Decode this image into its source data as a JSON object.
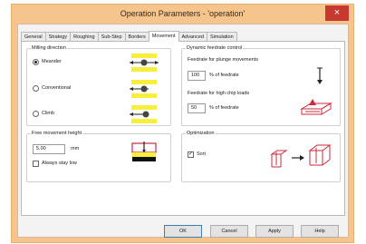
{
  "window": {
    "title": "Operation Parameters - 'operation'",
    "close_glyph": "×"
  },
  "tabs": [
    "General",
    "Strategy",
    "Roughing",
    "Sub-Step",
    "Borders",
    "Movement",
    "Advanced",
    "Simulation"
  ],
  "active_tab": "Movement",
  "milling_direction": {
    "title": "Milling direction",
    "options": [
      {
        "label": "Meander",
        "selected": true,
        "icon": "meander-direction-icon"
      },
      {
        "label": "Conventional",
        "selected": false,
        "icon": "conventional-direction-icon"
      },
      {
        "label": "Climb",
        "selected": false,
        "icon": "climb-direction-icon"
      }
    ]
  },
  "free_movement": {
    "title": "Free movement height",
    "height_value": "5.00",
    "unit": "mm",
    "always_stay_low_label": "Always stay low",
    "always_stay_low_checked": false,
    "icon": "free-movement-height-icon"
  },
  "dynamic_feedrate": {
    "title": "Dynamic feedrate control",
    "plunge_label": "Feedrate for plunge movements",
    "plunge_value": "100",
    "plunge_unit": "% of feedrate",
    "plunge_icon": "plunge-arrow-icon",
    "chip_label": "Feedrate for high chip loads",
    "chip_value": "50",
    "chip_unit": "% of feedrate",
    "chip_icon": "chip-load-icon"
  },
  "optimization": {
    "title": "Optimization",
    "sort_label": "Sort",
    "sort_checked": true,
    "icon": "sort-optimization-icon"
  },
  "buttons": {
    "ok": "OK",
    "cancel": "Cancel",
    "apply": "Apply",
    "help": "Help"
  },
  "colors": {
    "title_bar": "#f6c58e",
    "close": "#c7392f",
    "icon_red": "#d0283a"
  }
}
